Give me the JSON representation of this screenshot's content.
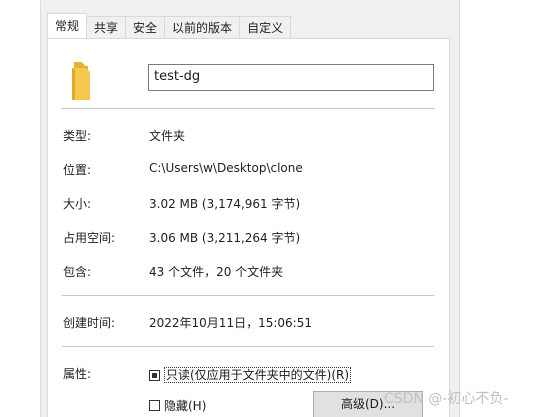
{
  "tabs": [
    {
      "label": "常规",
      "active": true
    },
    {
      "label": "共享",
      "active": false
    },
    {
      "label": "安全",
      "active": false
    },
    {
      "label": "以前的版本",
      "active": false
    },
    {
      "label": "自定义",
      "active": false
    }
  ],
  "general": {
    "folder_name": "test-dg",
    "type": {
      "label": "类型:",
      "value": "文件夹"
    },
    "location": {
      "label": "位置:",
      "value": "C:\\Users\\w\\Desktop\\clone"
    },
    "size": {
      "label": "大小:",
      "value": "3.02 MB (3,174,961 字节)"
    },
    "size_on_disk": {
      "label": "占用空间:",
      "value": "3.06 MB (3,211,264 字节)"
    },
    "contains": {
      "label": "包含:",
      "value": "43 个文件，20 个文件夹"
    },
    "created": {
      "label": "创建时间:",
      "value": "2022年10月11日，15:06:51"
    },
    "attributes": {
      "label": "属性:",
      "readonly": {
        "label": "只读(仅应用于文件夹中的文件)(R)",
        "state": "indeterminate"
      },
      "hidden": {
        "label": "隐藏(H)",
        "state": "unchecked"
      },
      "advanced_button": "高级(D)..."
    }
  },
  "watermark": "CSDN @-初心不负-",
  "colors": {
    "dialog_bg": "#f0f0f0",
    "panel_bg": "#ffffff",
    "separator": "#c8c8c8",
    "folder": "#f5c850"
  },
  "icons": {
    "folder": "folder-icon"
  }
}
